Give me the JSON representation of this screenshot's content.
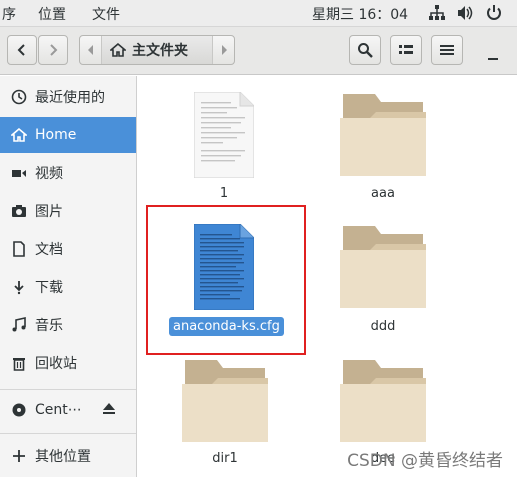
{
  "topbar": {
    "menu": [
      "序",
      "位置",
      "文件"
    ],
    "clock": "星期三 16：04",
    "icons": [
      "network-icon",
      "volume-icon",
      "power-icon"
    ]
  },
  "toolbar": {
    "path_label": "主文件夹",
    "buttons": [
      "back-icon",
      "forward-icon",
      "search-icon",
      "view-grid-icon",
      "menu-icon",
      "minimize-icon"
    ]
  },
  "sidebar": {
    "items": [
      {
        "label": "最近使用的",
        "icon": "recent-icon"
      },
      {
        "label": "Home",
        "icon": "home-icon",
        "active": true
      },
      {
        "label": "视频",
        "icon": "video-icon"
      },
      {
        "label": "图片",
        "icon": "camera-icon"
      },
      {
        "label": "文档",
        "icon": "document-icon"
      },
      {
        "label": "下载",
        "icon": "download-icon"
      },
      {
        "label": "音乐",
        "icon": "music-icon"
      },
      {
        "label": "回收站",
        "icon": "trash-icon"
      },
      {
        "label": "Cent⋯",
        "icon": "disc-icon"
      },
      {
        "label": "其他位置",
        "icon": "plus-icon"
      }
    ]
  },
  "files": [
    {
      "name": "1",
      "type": "text-file"
    },
    {
      "name": "aaa",
      "type": "folder"
    },
    {
      "name": "anaconda-ks.cfg",
      "type": "text-file",
      "selected": true
    },
    {
      "name": "ddd",
      "type": "folder"
    },
    {
      "name": "dir1",
      "type": "folder"
    },
    {
      "name": "dee",
      "type": "folder"
    }
  ],
  "watermark": "CSDN @黄昏终结者",
  "colors": {
    "accent": "#4a90d9",
    "folder": "#d9c7a7",
    "highlight": "#e02020"
  }
}
